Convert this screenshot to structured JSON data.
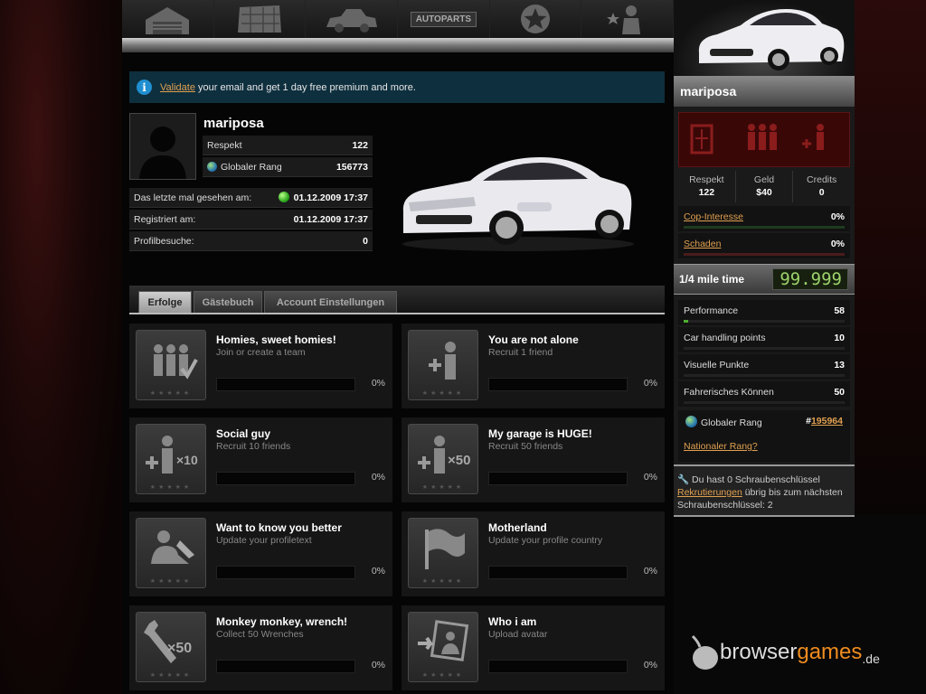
{
  "nav": {
    "autoparts_label": "AUTOPARTS"
  },
  "info": {
    "link_label": "Validate",
    "text": " your email and get 1 day free premium and more."
  },
  "profile": {
    "username": "mariposa",
    "respekt_label": "Respekt",
    "respekt_value": "122",
    "rank_label": "Globaler Rang",
    "rank_value": "156773",
    "last_seen_label": "Das letzte mal gesehen am:",
    "last_seen_value": "01.12.2009 17:37",
    "registered_label": "Registriert am:",
    "registered_value": "01.12.2009 17:37",
    "visits_label": "Profilbesuche:",
    "visits_value": "0"
  },
  "tabs": [
    "Erfolge",
    "Gästebuch",
    "Account Einstellungen"
  ],
  "achievements": [
    {
      "title": "Homies, sweet homies!",
      "desc": "Join or create a team",
      "pct": "0%"
    },
    {
      "title": "You are not alone",
      "desc": "Recruit 1 friend",
      "pct": "0%"
    },
    {
      "title": "Social guy",
      "desc": "Recruit 10 friends",
      "pct": "0%"
    },
    {
      "title": "My garage is HUGE!",
      "desc": "Recruit 50 friends",
      "pct": "0%"
    },
    {
      "title": "Want to know you better",
      "desc": "Update your profiletext",
      "pct": "0%"
    },
    {
      "title": "Motherland",
      "desc": "Update your profile country",
      "pct": "0%"
    },
    {
      "title": "Monkey monkey, wrench!",
      "desc": "Collect 50 Wrenches",
      "pct": "0%"
    },
    {
      "title": "Who i am",
      "desc": "Upload avatar",
      "pct": "0%"
    }
  ],
  "badges": {
    "x10": "×10",
    "x50": "×50"
  },
  "sidebar": {
    "username": "mariposa",
    "respekt_label": "Respekt",
    "respekt_value": "122",
    "geld_label": "Geld",
    "geld_value": "$40",
    "credits_label": "Credits",
    "credits_value": "0",
    "cop_label": "Cop-Interesse",
    "cop_value": "0%",
    "damage_label": "Schaden",
    "damage_value": "0%",
    "mile_label": "1/4 mile time",
    "mile_value": "99.999",
    "performance_label": "Performance",
    "performance_value": "58",
    "handling_label": "Car handling points",
    "handling_value": "10",
    "visual_label": "Visuelle Punkte",
    "visual_value": "13",
    "driving_label": "Fahrerisches Können",
    "driving_value": "50",
    "global_rank_label": "Globaler Rang",
    "global_rank_hash": "#",
    "global_rank_value": "195964",
    "national_rank_link": "Nationaler Rang?",
    "wrench_text_1": "Du hast 0 Schraubenschlüssel",
    "wrench_link": "Rekrutierungen",
    "wrench_text_2": " übrig bis zum nächsten Schraubenschlüssel: 2"
  },
  "brand": {
    "name_a": "browser",
    "name_b": "games",
    "tld": ".de"
  },
  "colors": {
    "link": "#e0a050",
    "performance_bar": "#4caf2e",
    "cop_bar": "#2f6a2f",
    "damage_bar": "#7a2a2a",
    "lcd_text": "#9cd36b"
  }
}
